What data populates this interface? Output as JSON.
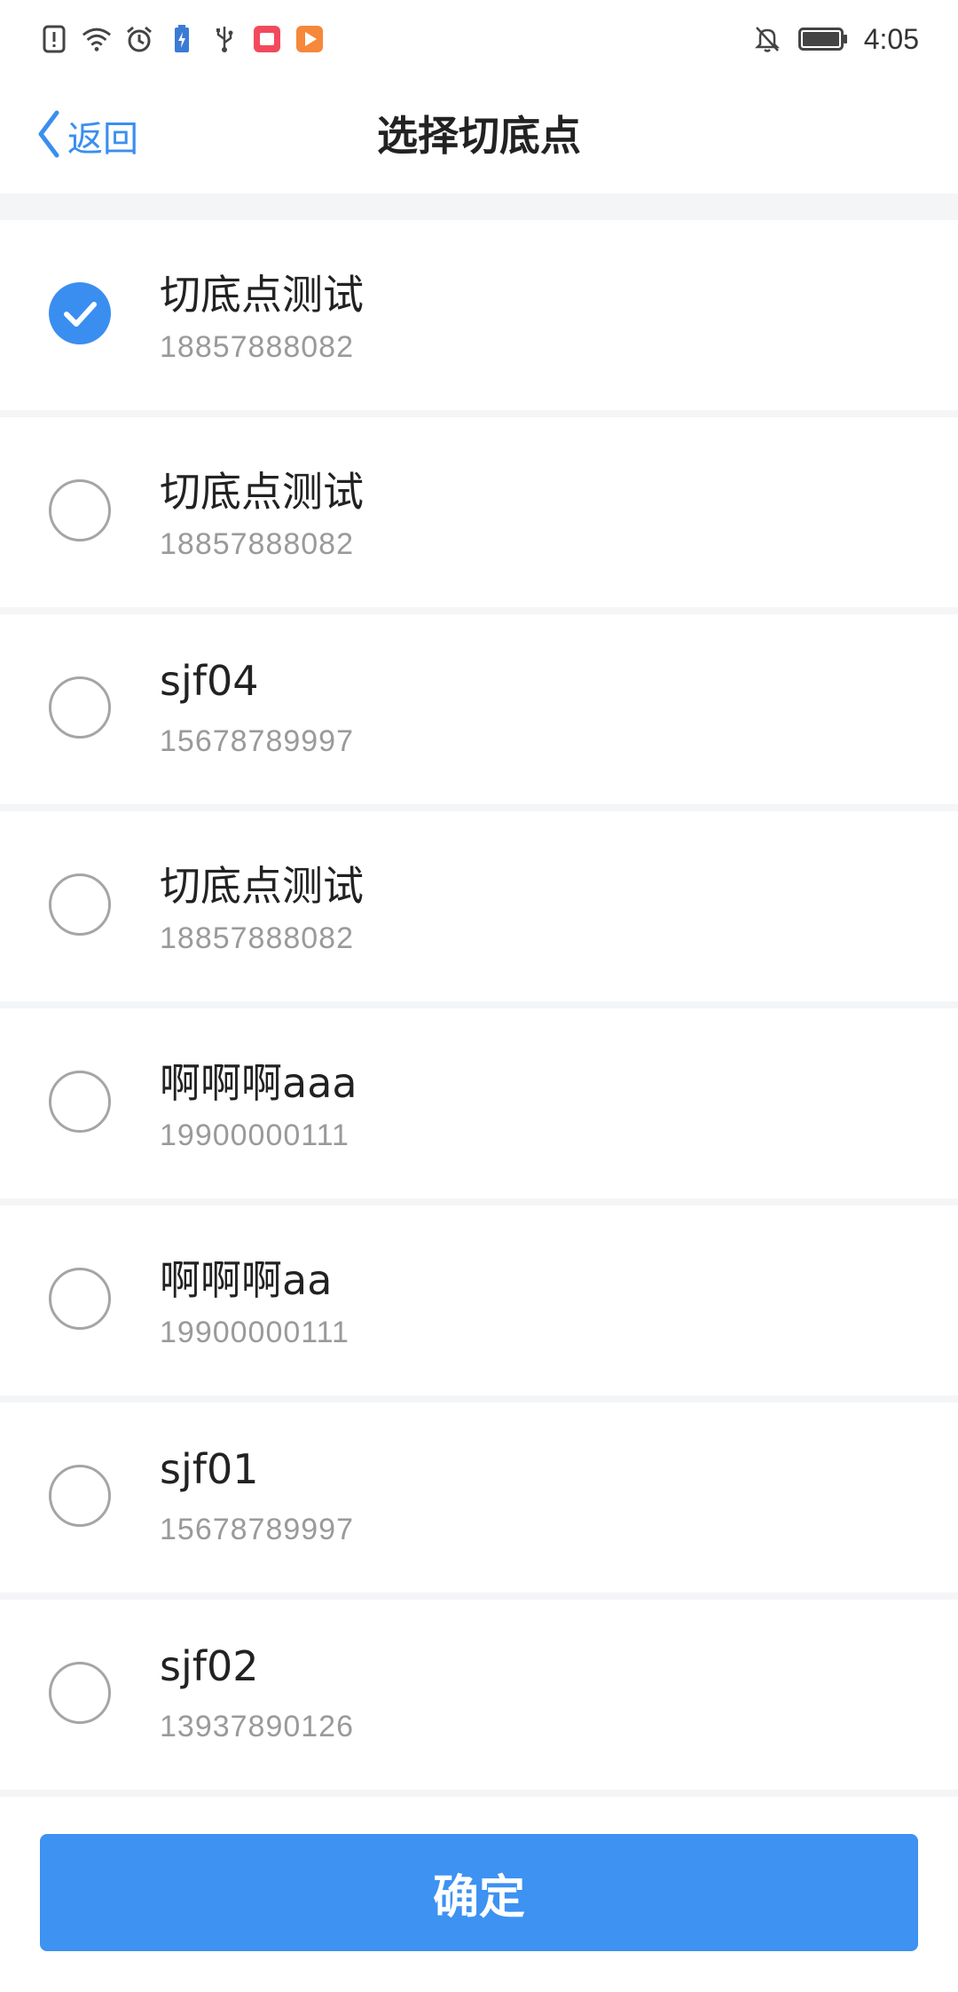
{
  "status_bar": {
    "time": "4:05",
    "left_icons": [
      "alert-icon",
      "wifi-icon",
      "alarm-icon",
      "battery-saver-icon",
      "usb-icon",
      "app-notification-red-icon",
      "app-notification-orange-icon"
    ],
    "right_icons": [
      "notifications-off-icon",
      "battery-icon"
    ]
  },
  "nav": {
    "back_label": "返回",
    "title": "选择切底点"
  },
  "items": [
    {
      "name": "切底点测试",
      "phone": "18857888082",
      "checked": true
    },
    {
      "name": "切底点测试",
      "phone": "18857888082",
      "checked": false
    },
    {
      "name": "sjf04",
      "phone": "15678789997",
      "checked": false
    },
    {
      "name": "切底点测试",
      "phone": "18857888082",
      "checked": false
    },
    {
      "name": "啊啊啊aaa",
      "phone": "19900000111",
      "checked": false
    },
    {
      "name": "啊啊啊aa",
      "phone": "19900000111",
      "checked": false
    },
    {
      "name": "sjf01",
      "phone": "15678789997",
      "checked": false
    },
    {
      "name": "sjf02",
      "phone": "13937890126",
      "checked": false
    }
  ],
  "confirm_label": "确定",
  "colors": {
    "accent": "#3a8ef0",
    "divider": "#f4f5f7",
    "secondary_text": "#9a9a9a"
  }
}
